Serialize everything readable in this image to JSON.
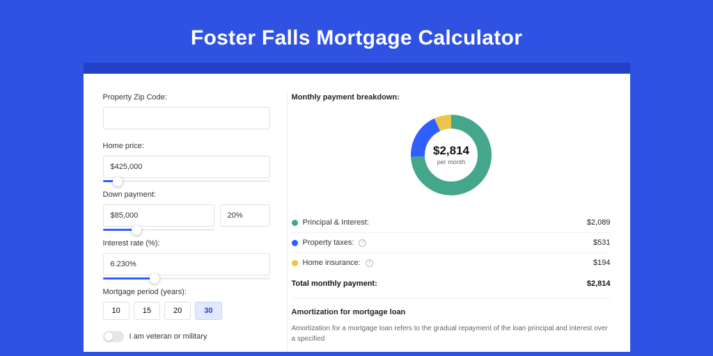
{
  "colors": {
    "accent": "#3052e3",
    "green": "#44a78b",
    "blue": "#2e5fff",
    "yellow": "#ecc44a"
  },
  "header": {
    "title": "Foster Falls Mortgage Calculator"
  },
  "form": {
    "zip_label": "Property Zip Code:",
    "zip_value": "",
    "price_label": "Home price:",
    "price_value": "$425,000",
    "price_slider_pct": 9,
    "down_label": "Down payment:",
    "down_value": "$85,000",
    "down_pct": "20%",
    "down_slider_pct": 20,
    "rate_label": "Interest rate (%):",
    "rate_value": "6.230%",
    "rate_slider_pct": 31,
    "period_label": "Mortgage period (years):",
    "periods": [
      "10",
      "15",
      "20",
      "30"
    ],
    "period_active_idx": 3,
    "veteran_label": "I am veteran or military"
  },
  "breakdown": {
    "title": "Monthly payment breakdown:",
    "center_value": "$2,814",
    "center_sub": "per month",
    "rows": [
      {
        "label": "Principal & Interest:",
        "value": "$2,089",
        "color": "#44a78b",
        "help": false
      },
      {
        "label": "Property taxes:",
        "value": "$531",
        "color": "#2e5fff",
        "help": true
      },
      {
        "label": "Home insurance:",
        "value": "$194",
        "color": "#ecc44a",
        "help": true
      }
    ],
    "total_label": "Total monthly payment:",
    "total_value": "$2,814"
  },
  "amort": {
    "title": "Amortization for mortgage loan",
    "body": "Amortization for a mortgage loan refers to the gradual repayment of the loan principal and interest over a specified"
  },
  "chart_data": {
    "type": "pie",
    "title": "Monthly payment breakdown",
    "series": [
      {
        "name": "Principal & Interest",
        "value": 2089,
        "color": "#44a78b"
      },
      {
        "name": "Property taxes",
        "value": 531,
        "color": "#2e5fff"
      },
      {
        "name": "Home insurance",
        "value": 194,
        "color": "#ecc44a"
      }
    ],
    "total": 2814,
    "center_label": "$2,814 per month"
  }
}
